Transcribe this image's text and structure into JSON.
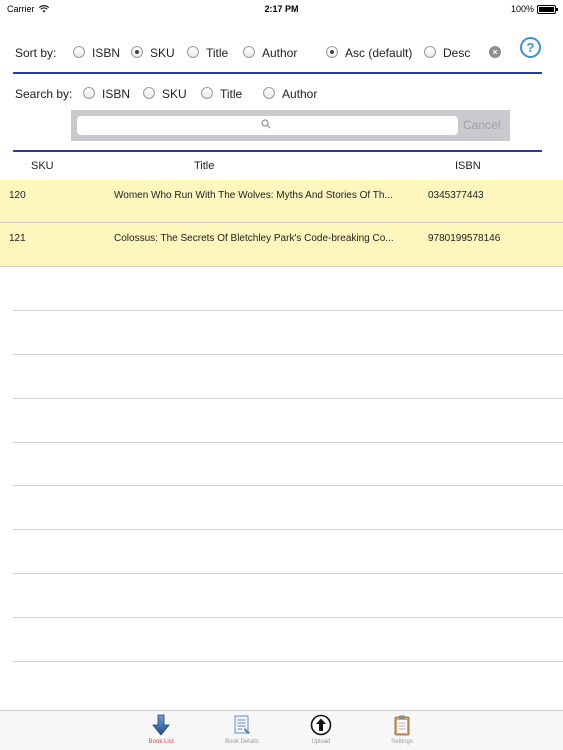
{
  "status_bar": {
    "carrier": "Carrier",
    "time": "2:17 PM",
    "battery": "100%"
  },
  "sort": {
    "label": "Sort by:",
    "options": [
      {
        "label": "ISBN",
        "selected": false
      },
      {
        "label": "SKU",
        "selected": true
      },
      {
        "label": "Title",
        "selected": false
      },
      {
        "label": "Author",
        "selected": false
      }
    ],
    "order": [
      {
        "label": "Asc (default)",
        "selected": true
      },
      {
        "label": "Desc",
        "selected": false
      }
    ]
  },
  "search": {
    "label": "Search by:",
    "options": [
      {
        "label": "ISBN",
        "selected": false
      },
      {
        "label": "SKU",
        "selected": false
      },
      {
        "label": "Title",
        "selected": false
      },
      {
        "label": "Author",
        "selected": false
      }
    ],
    "value": "",
    "cancel_label": "Cancel"
  },
  "table": {
    "columns": [
      "SKU",
      "Title",
      "ISBN"
    ],
    "rows": [
      {
        "sku": "120",
        "title": "Women Who Run With The Wolves:  Myths And Stories Of Th...",
        "isbn": "0345377443"
      },
      {
        "sku": "121",
        "title": "Colossus: The Secrets Of Bletchley Park's Code-breaking Co...",
        "isbn": "9780199578146"
      }
    ]
  },
  "tabs": [
    {
      "label": "Book List",
      "active": true,
      "icon": "download-arrow-icon"
    },
    {
      "label": "Book Details",
      "active": false,
      "icon": "document-icon"
    },
    {
      "label": "Upload",
      "active": false,
      "icon": "upload-arrow-icon"
    },
    {
      "label": "Settings",
      "active": false,
      "icon": "clipboard-icon"
    }
  ],
  "colors": {
    "accent": "#2b3c9e",
    "help": "#3a8fdc",
    "row_highlight": "#fdf6bd",
    "active_tab": "#e0443b"
  }
}
